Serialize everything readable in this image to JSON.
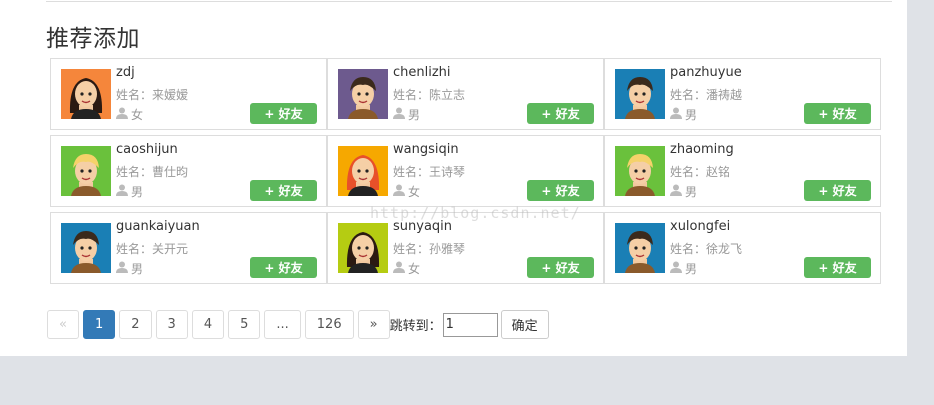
{
  "section_title": "推荐添加",
  "add_button_label": "+ 好友",
  "cards": [
    {
      "username": "zdj",
      "realname": "姓名：来嫒嫒",
      "gender": "女",
      "avatar": "female-avatar-orange",
      "bg": "#f5863b"
    },
    {
      "username": "chenlizhi",
      "realname": "姓名：陈立志",
      "gender": "男",
      "avatar": "male-avatar-purple",
      "bg": "#6d5a8e"
    },
    {
      "username": "panzhuyue",
      "realname": "姓名：潘祷越",
      "gender": "男",
      "avatar": "male-avatar-blue",
      "bg": "#1a7fb5"
    },
    {
      "username": "caoshijun",
      "realname": "姓名：曹仕昀",
      "gender": "男",
      "avatar": "male-avatar-green",
      "bg": "#6ac13c"
    },
    {
      "username": "wangsiqin",
      "realname": "姓名：王诗琴",
      "gender": "女",
      "avatar": "female-avatar-yellow",
      "bg": "#f6a800"
    },
    {
      "username": "zhaoming",
      "realname": "姓名：赵铭",
      "gender": "男",
      "avatar": "male-avatar-green",
      "bg": "#6ac13c"
    },
    {
      "username": "guankaiyuan",
      "realname": "姓名：关开元",
      "gender": "男",
      "avatar": "male-avatar-blue",
      "bg": "#1a7fb5"
    },
    {
      "username": "sunyaqin",
      "realname": "姓名：孙雅琴",
      "gender": "女",
      "avatar": "female-avatar-lime",
      "bg": "#b5cc12"
    },
    {
      "username": "xulongfei",
      "realname": "姓名：徐龙飞",
      "gender": "男",
      "avatar": "male-avatar-blue",
      "bg": "#1a7fb5"
    }
  ],
  "pagination": {
    "prev": "«",
    "pages": [
      "1",
      "2",
      "3",
      "4",
      "5",
      "...",
      "126"
    ],
    "active": "1",
    "next": "»",
    "jump_label": "跳转到：",
    "jump_value": "1",
    "confirm_label": "确定"
  },
  "watermark": "http://blog.csdn.net/",
  "colors": {
    "accent_green": "#5cb85c",
    "active_blue": "#337ab7"
  }
}
